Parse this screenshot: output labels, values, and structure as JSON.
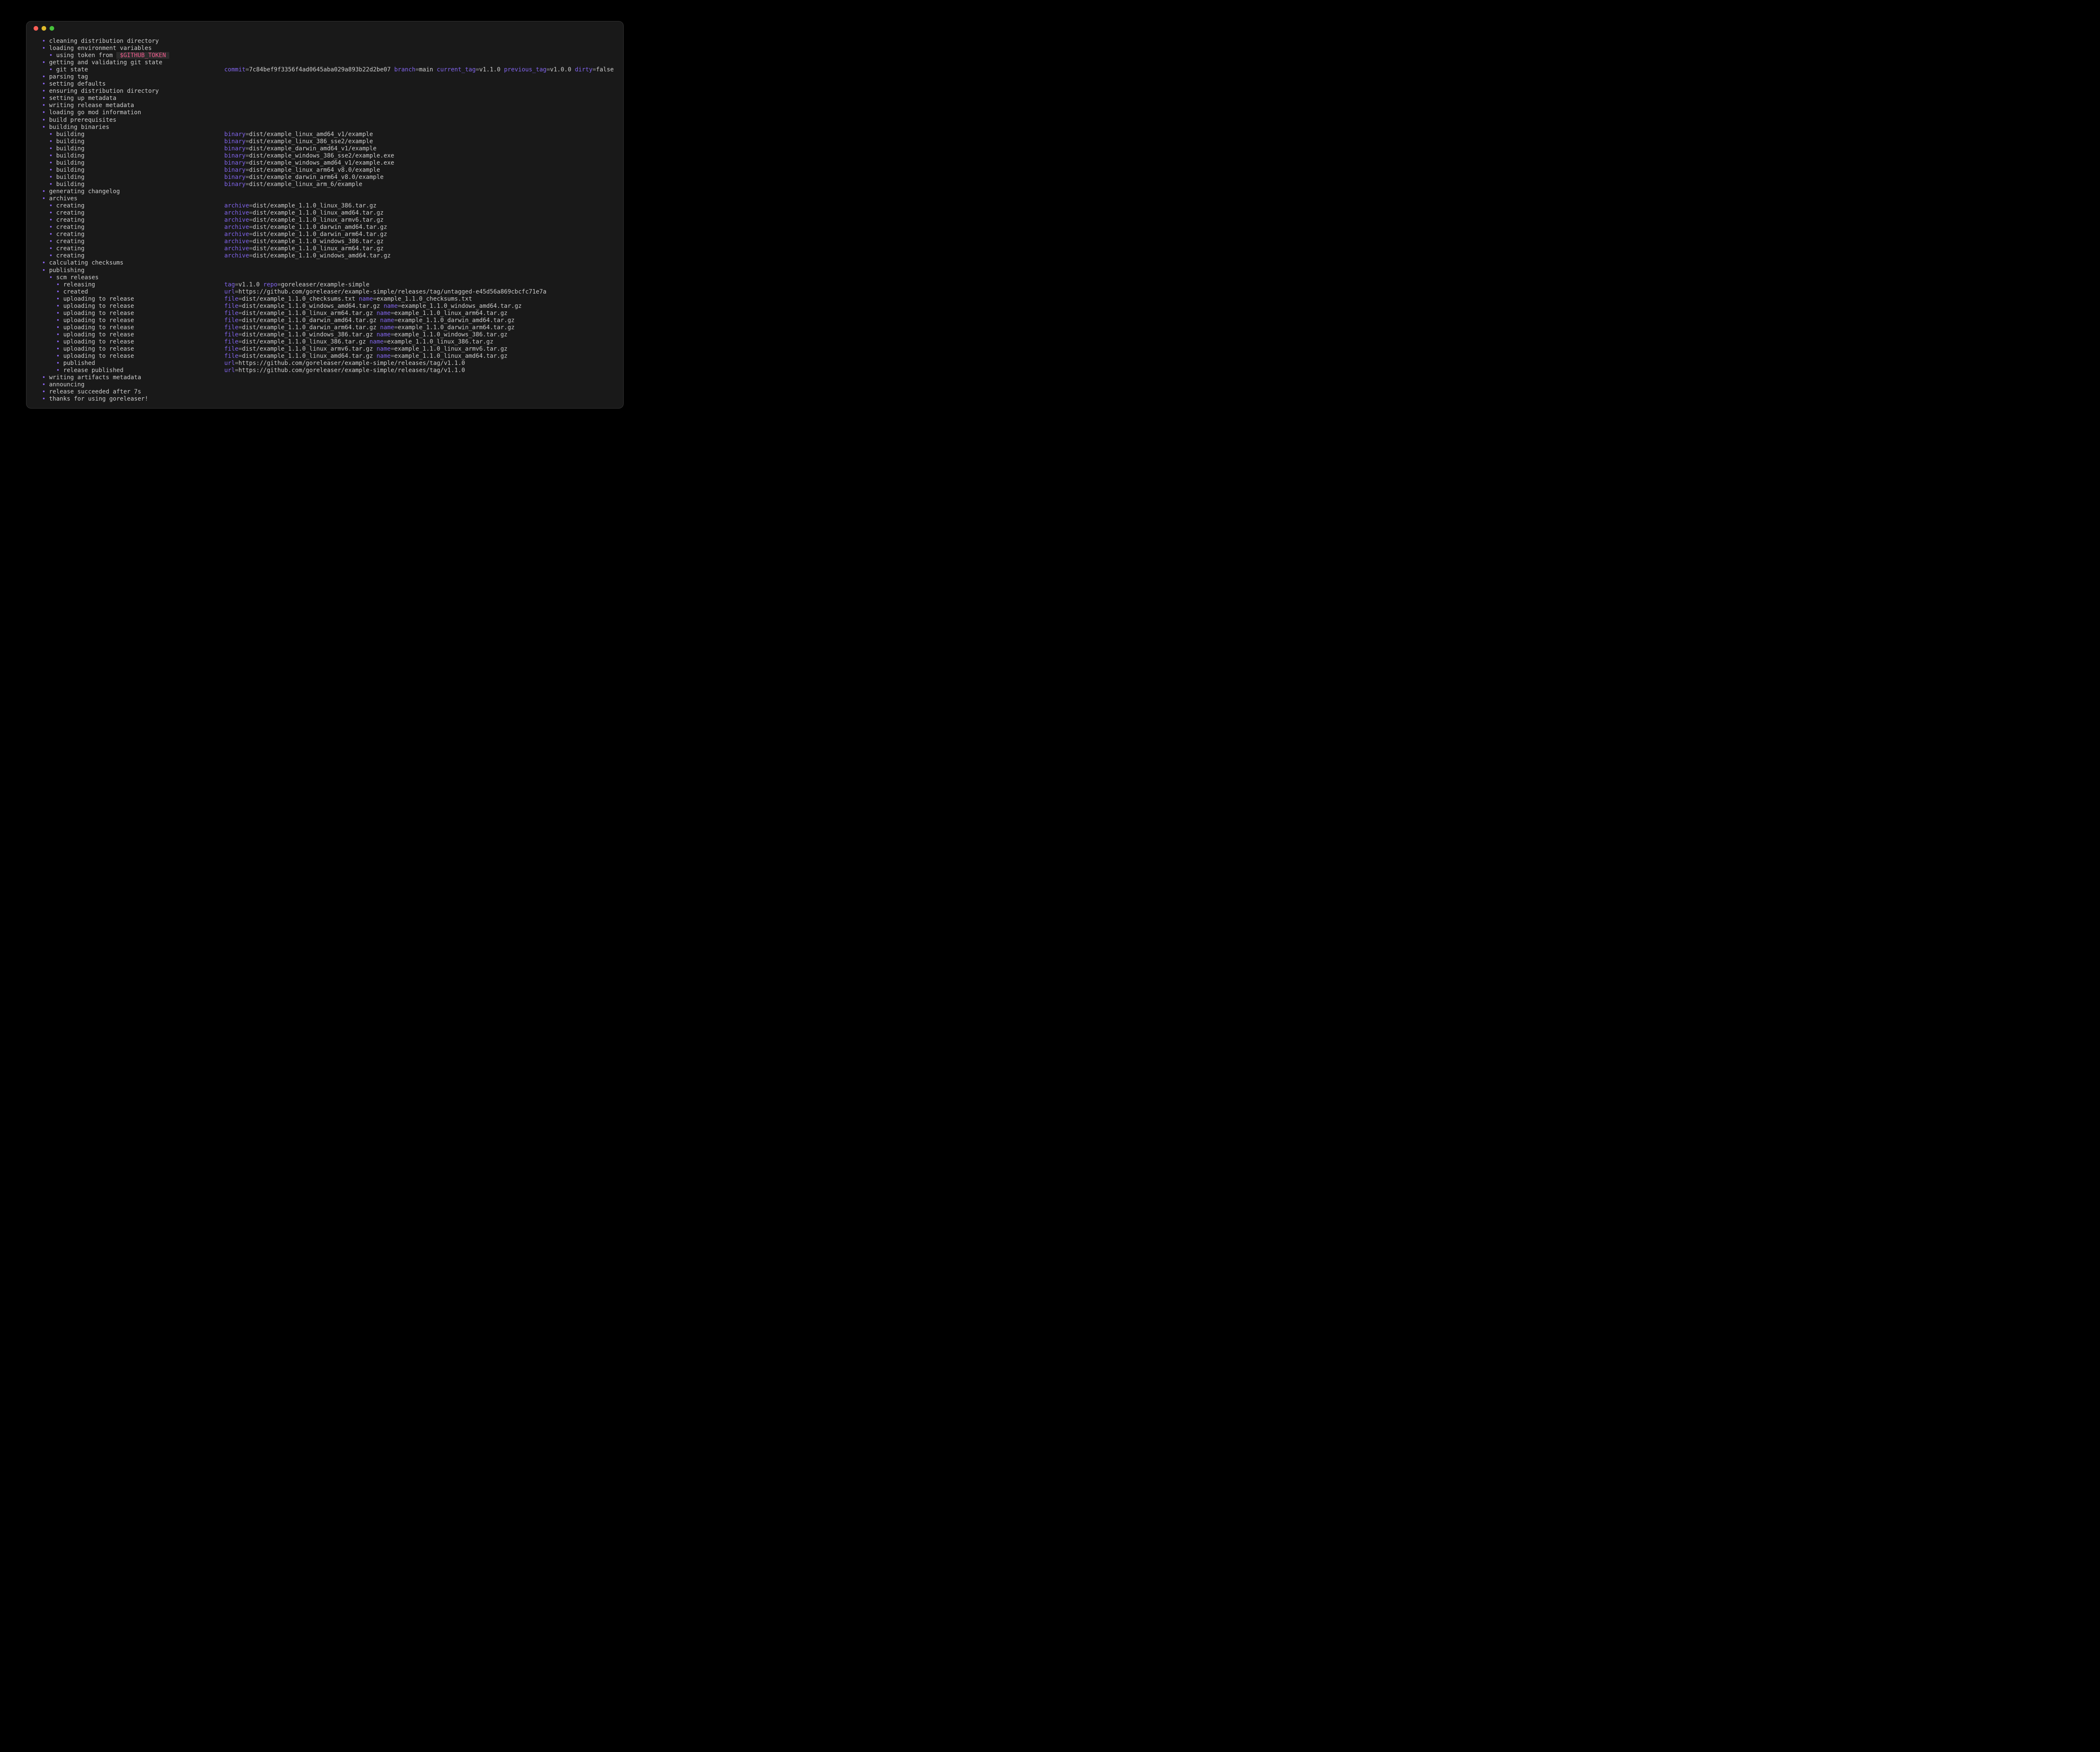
{
  "window": {
    "type": "terminal",
    "title": ""
  },
  "titlebar": {
    "buttons": [
      "close",
      "minimize",
      "zoom"
    ]
  },
  "colors": {
    "bg": "#000000",
    "window_bg": "#191919",
    "border": "#343434",
    "text": "#cdcdcd",
    "bullet": "#8a63f0",
    "key": "#8265ee",
    "equals": "#909090",
    "token": "#f25d8e",
    "token_bg": "#2b2b2b",
    "traffic_red": "#ff5f57",
    "traffic_yellow": "#e0bb2b",
    "traffic_green": "#46c33b"
  },
  "log": {
    "lines": [
      {
        "level": 0,
        "label": "cleaning distribution directory"
      },
      {
        "level": 0,
        "label": "loading environment variables"
      },
      {
        "level": 1,
        "label": "using token from",
        "token": "$GITHUB_TOKEN"
      },
      {
        "level": 0,
        "label": "getting and validating git state"
      },
      {
        "level": 1,
        "label": "git state",
        "fields": [
          [
            "commit",
            "7c84bef9f3356f4ad0645aba029a893b22d2be07"
          ],
          [
            "branch",
            "main"
          ],
          [
            "current_tag",
            "v1.1.0"
          ],
          [
            "previous_tag",
            "v1.0.0"
          ],
          [
            "dirty",
            "false"
          ]
        ]
      },
      {
        "level": 0,
        "label": "parsing tag"
      },
      {
        "level": 0,
        "label": "setting defaults"
      },
      {
        "level": 0,
        "label": "ensuring distribution directory"
      },
      {
        "level": 0,
        "label": "setting up metadata"
      },
      {
        "level": 0,
        "label": "writing release metadata"
      },
      {
        "level": 0,
        "label": "loading go mod information"
      },
      {
        "level": 0,
        "label": "build prerequisites"
      },
      {
        "level": 0,
        "label": "building binaries"
      },
      {
        "level": 1,
        "label": "building",
        "fields": [
          [
            "binary",
            "dist/example_linux_amd64_v1/example"
          ]
        ]
      },
      {
        "level": 1,
        "label": "building",
        "fields": [
          [
            "binary",
            "dist/example_linux_386_sse2/example"
          ]
        ]
      },
      {
        "level": 1,
        "label": "building",
        "fields": [
          [
            "binary",
            "dist/example_darwin_amd64_v1/example"
          ]
        ]
      },
      {
        "level": 1,
        "label": "building",
        "fields": [
          [
            "binary",
            "dist/example_windows_386_sse2/example.exe"
          ]
        ]
      },
      {
        "level": 1,
        "label": "building",
        "fields": [
          [
            "binary",
            "dist/example_windows_amd64_v1/example.exe"
          ]
        ]
      },
      {
        "level": 1,
        "label": "building",
        "fields": [
          [
            "binary",
            "dist/example_linux_arm64_v8.0/example"
          ]
        ]
      },
      {
        "level": 1,
        "label": "building",
        "fields": [
          [
            "binary",
            "dist/example_darwin_arm64_v8.0/example"
          ]
        ]
      },
      {
        "level": 1,
        "label": "building",
        "fields": [
          [
            "binary",
            "dist/example_linux_arm_6/example"
          ]
        ]
      },
      {
        "level": 0,
        "label": "generating changelog"
      },
      {
        "level": 0,
        "label": "archives"
      },
      {
        "level": 1,
        "label": "creating",
        "fields": [
          [
            "archive",
            "dist/example_1.1.0_linux_386.tar.gz"
          ]
        ]
      },
      {
        "level": 1,
        "label": "creating",
        "fields": [
          [
            "archive",
            "dist/example_1.1.0_linux_amd64.tar.gz"
          ]
        ]
      },
      {
        "level": 1,
        "label": "creating",
        "fields": [
          [
            "archive",
            "dist/example_1.1.0_linux_armv6.tar.gz"
          ]
        ]
      },
      {
        "level": 1,
        "label": "creating",
        "fields": [
          [
            "archive",
            "dist/example_1.1.0_darwin_amd64.tar.gz"
          ]
        ]
      },
      {
        "level": 1,
        "label": "creating",
        "fields": [
          [
            "archive",
            "dist/example_1.1.0_darwin_arm64.tar.gz"
          ]
        ]
      },
      {
        "level": 1,
        "label": "creating",
        "fields": [
          [
            "archive",
            "dist/example_1.1.0_windows_386.tar.gz"
          ]
        ]
      },
      {
        "level": 1,
        "label": "creating",
        "fields": [
          [
            "archive",
            "dist/example_1.1.0_linux_arm64.tar.gz"
          ]
        ]
      },
      {
        "level": 1,
        "label": "creating",
        "fields": [
          [
            "archive",
            "dist/example_1.1.0_windows_amd64.tar.gz"
          ]
        ]
      },
      {
        "level": 0,
        "label": "calculating checksums"
      },
      {
        "level": 0,
        "label": "publishing"
      },
      {
        "level": 1,
        "label": "scm releases"
      },
      {
        "level": 2,
        "label": "releasing",
        "fields": [
          [
            "tag",
            "v1.1.0"
          ],
          [
            "repo",
            "goreleaser/example-simple"
          ]
        ]
      },
      {
        "level": 2,
        "label": "created",
        "fields": [
          [
            "url",
            "https://github.com/goreleaser/example-simple/releases/tag/untagged-e45d56a869cbcfc71e7a"
          ]
        ]
      },
      {
        "level": 2,
        "label": "uploading to release",
        "fields": [
          [
            "file",
            "dist/example_1.1.0_checksums.txt"
          ],
          [
            "name",
            "example_1.1.0_checksums.txt"
          ]
        ]
      },
      {
        "level": 2,
        "label": "uploading to release",
        "fields": [
          [
            "file",
            "dist/example_1.1.0_windows_amd64.tar.gz"
          ],
          [
            "name",
            "example_1.1.0_windows_amd64.tar.gz"
          ]
        ]
      },
      {
        "level": 2,
        "label": "uploading to release",
        "fields": [
          [
            "file",
            "dist/example_1.1.0_linux_arm64.tar.gz"
          ],
          [
            "name",
            "example_1.1.0_linux_arm64.tar.gz"
          ]
        ]
      },
      {
        "level": 2,
        "label": "uploading to release",
        "fields": [
          [
            "file",
            "dist/example_1.1.0_darwin_amd64.tar.gz"
          ],
          [
            "name",
            "example_1.1.0_darwin_amd64.tar.gz"
          ]
        ]
      },
      {
        "level": 2,
        "label": "uploading to release",
        "fields": [
          [
            "file",
            "dist/example_1.1.0_darwin_arm64.tar.gz"
          ],
          [
            "name",
            "example_1.1.0_darwin_arm64.tar.gz"
          ]
        ]
      },
      {
        "level": 2,
        "label": "uploading to release",
        "fields": [
          [
            "file",
            "dist/example_1.1.0_windows_386.tar.gz"
          ],
          [
            "name",
            "example_1.1.0_windows_386.tar.gz"
          ]
        ]
      },
      {
        "level": 2,
        "label": "uploading to release",
        "fields": [
          [
            "file",
            "dist/example_1.1.0_linux_386.tar.gz"
          ],
          [
            "name",
            "example_1.1.0_linux_386.tar.gz"
          ]
        ]
      },
      {
        "level": 2,
        "label": "uploading to release",
        "fields": [
          [
            "file",
            "dist/example_1.1.0_linux_armv6.tar.gz"
          ],
          [
            "name",
            "example_1.1.0_linux_armv6.tar.gz"
          ]
        ]
      },
      {
        "level": 2,
        "label": "uploading to release",
        "fields": [
          [
            "file",
            "dist/example_1.1.0_linux_amd64.tar.gz"
          ],
          [
            "name",
            "example_1.1.0_linux_amd64.tar.gz"
          ]
        ]
      },
      {
        "level": 2,
        "label": "published",
        "fields": [
          [
            "url",
            "https://github.com/goreleaser/example-simple/releases/tag/v1.1.0"
          ]
        ]
      },
      {
        "level": 2,
        "label": "release published",
        "fields": [
          [
            "url",
            "https://github.com/goreleaser/example-simple/releases/tag/v1.1.0"
          ]
        ]
      },
      {
        "level": 0,
        "label": "writing artifacts metadata"
      },
      {
        "level": 0,
        "label": "announcing"
      },
      {
        "level": 0,
        "label": "release succeeded after 7s"
      },
      {
        "level": 0,
        "label": "thanks for using goreleaser!"
      }
    ]
  }
}
